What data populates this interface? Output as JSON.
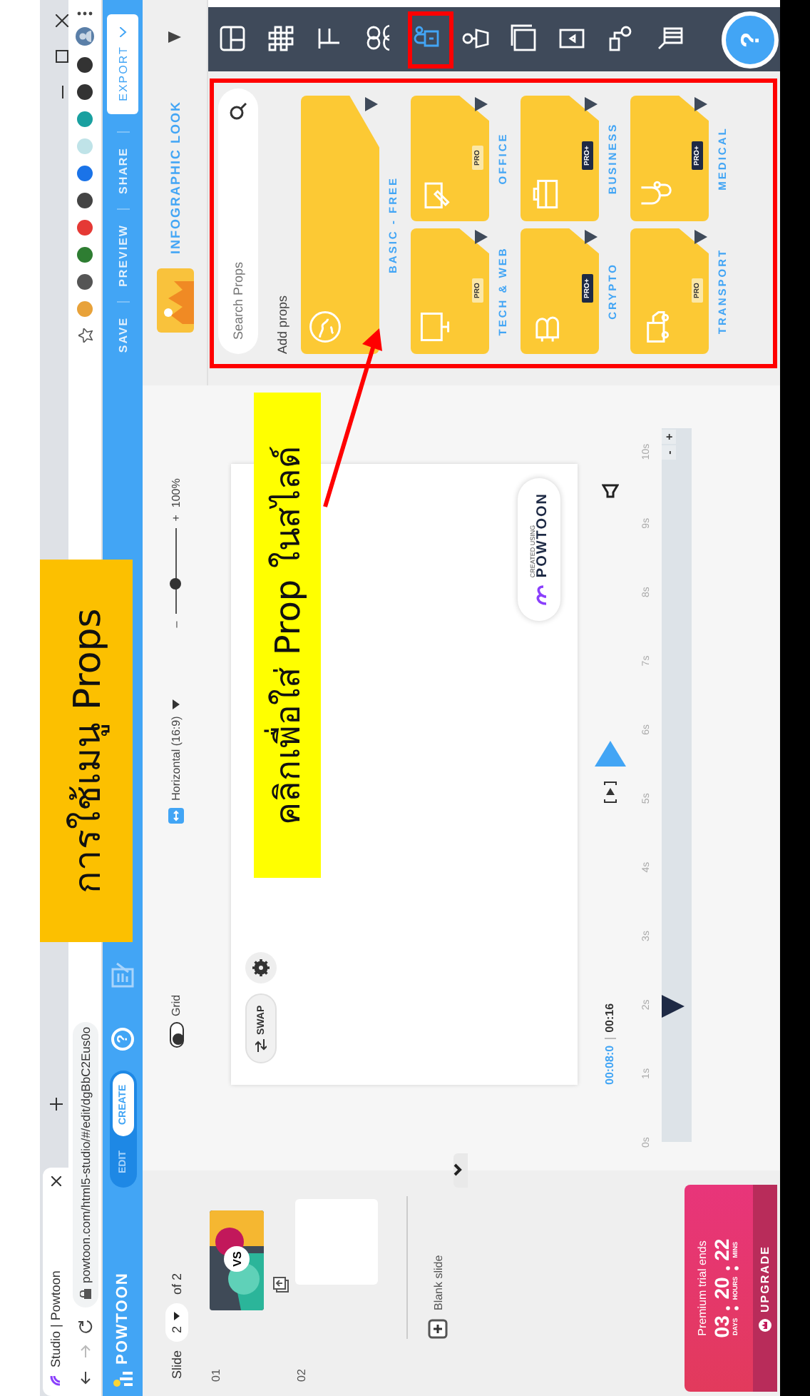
{
  "annotations": {
    "title": "การใช้เมนู Props",
    "callout": "คลิกเพื่อใส่ Prop ในสไลด์"
  },
  "browser": {
    "tab_title": "Studio | Powtoon",
    "url": "powtoon.com/html5-studio/#/edit/dgBbC2Eus0o"
  },
  "app_bar": {
    "logo": "POWTOON",
    "modes": [
      {
        "label": "EDIT",
        "selected": false
      },
      {
        "label": "CREATE",
        "selected": true
      }
    ],
    "help": "?",
    "actions": [
      "SAVE",
      "PREVIEW",
      "SHARE"
    ],
    "export": "EXPORT"
  },
  "slides_panel": {
    "slide_label": "Slide",
    "slide_number": "2",
    "slide_total": "of 2",
    "slides": [
      {
        "number": "01",
        "kind": "thumbnail",
        "thumbnail_text": "VS"
      },
      {
        "number": "02",
        "kind": "blank"
      }
    ],
    "add_label": "Blank slide"
  },
  "canvas_toolbar": {
    "grid": {
      "label": "Grid",
      "on": false
    },
    "format": "Horizontal (16:9)",
    "zoom": {
      "minus": "–",
      "plus": "+",
      "level": 0.35,
      "reading": "100%"
    }
  },
  "stage": {
    "swap": "SWAP",
    "badge_small": "CREATED USING",
    "badge_logo": "POWTOON"
  },
  "playback": {
    "current": "00:08:0",
    "total": "00:16"
  },
  "timeline": {
    "ticks": [
      "0s",
      "1s",
      "2s",
      "3s",
      "4s",
      "5s",
      "6s",
      "7s",
      "8s",
      "9s",
      "10s"
    ],
    "zoom_in": "+",
    "zoom_out": "-",
    "playhead": {
      "level": 0.19
    }
  },
  "trial": {
    "label": "Premium trial ends",
    "days": "03",
    "days_unit": "DAYS",
    "hours": "20",
    "hours_unit": "HOURS",
    "mins": "22",
    "mins_unit": "MINS",
    "upgrade": "UPGRADE"
  },
  "props_panel": {
    "look": "INFOGRAPHIC LOOK",
    "search_placeholder": "Search Props",
    "heading": "Add props",
    "categories": [
      {
        "label": "BASIC - FREE",
        "kind": "wide"
      },
      {
        "label": "TECH & WEB",
        "kind": "card",
        "badge": "PRO"
      },
      {
        "label": "OFFICE",
        "kind": "card",
        "badge": "PRO"
      },
      {
        "label": "CRYPTO",
        "kind": "card",
        "badge": "PRO+"
      },
      {
        "label": "BUSINESS",
        "kind": "card",
        "badge": "PRO+"
      },
      {
        "label": "TRANSPORT",
        "kind": "card",
        "badge": "PRO"
      },
      {
        "label": "MEDICAL",
        "kind": "card",
        "badge": "PRO+"
      }
    ]
  },
  "toolbar": {
    "items": [
      {
        "selected": false
      },
      {
        "selected": false
      },
      {
        "selected": false
      },
      {
        "selected": false
      },
      {
        "selected": true
      },
      {
        "selected": false
      },
      {
        "selected": false
      },
      {
        "selected": false
      },
      {
        "selected": false
      },
      {
        "selected": false
      }
    ],
    "help": "?"
  }
}
